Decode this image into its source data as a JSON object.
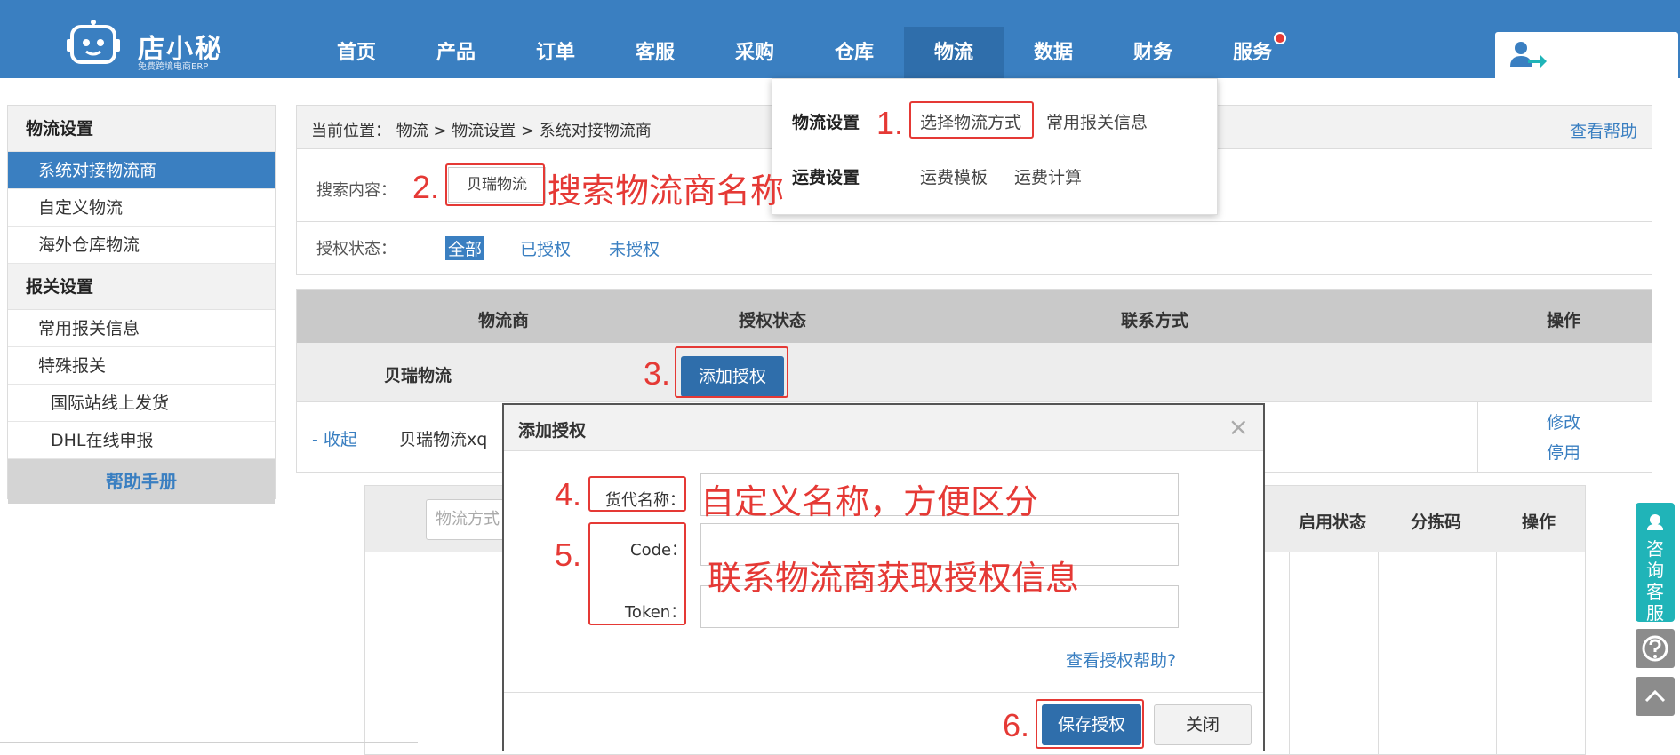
{
  "brand": {
    "name": "店小秘",
    "tagline": "免费跨境电商ERP"
  },
  "nav": {
    "items": [
      {
        "label": "首页"
      },
      {
        "label": "产品"
      },
      {
        "label": "订单"
      },
      {
        "label": "客服"
      },
      {
        "label": "采购"
      },
      {
        "label": "仓库"
      },
      {
        "label": "物流"
      },
      {
        "label": "数据"
      },
      {
        "label": "财务"
      },
      {
        "label": "服务"
      }
    ],
    "active": "物流"
  },
  "sidebar": {
    "section1": "物流设置",
    "items1": [
      {
        "label": "系统对接物流商"
      },
      {
        "label": "自定义物流"
      },
      {
        "label": "海外仓库物流"
      }
    ],
    "section2": "报关设置",
    "items2": [
      {
        "label": "常用报关信息"
      },
      {
        "label": "特殊报关"
      }
    ],
    "subitems": [
      {
        "label": "国际站线上发货"
      },
      {
        "label": "DHL在线申报"
      }
    ],
    "help": "帮助手册"
  },
  "breadcrumb": {
    "label": "当前位置：  物流 >  物流设置 > 系统对接物流商",
    "help_link": "查看帮助"
  },
  "filters": {
    "search_label": "搜索内容：",
    "search_value": "贝瑞物流",
    "status_label": "授权状态：",
    "status_options": [
      {
        "label": "全部"
      },
      {
        "label": "已授权"
      },
      {
        "label": "未授权"
      }
    ]
  },
  "table": {
    "headers": [
      "物流商",
      "授权状态",
      "联系方式",
      "操作"
    ],
    "row1": {
      "name": "贝瑞物流",
      "button": "添加授权"
    },
    "row2": {
      "collapse": "- 收起",
      "name": "贝瑞物流xq",
      "actions": [
        "修改",
        "停用"
      ]
    }
  },
  "subtable": {
    "input_placeholder": "物流方式",
    "headers": [
      "启用状态",
      "分拣码",
      "操作"
    ]
  },
  "dropdown": {
    "group1_title": "物流设置",
    "group1_items": [
      "选择物流方式",
      "常用报关信息"
    ],
    "group2_title": "运费设置",
    "group2_items": [
      "运费模板",
      "运费计算"
    ]
  },
  "modal": {
    "title": "添加授权",
    "close": "×",
    "fields": [
      {
        "label": "货代名称："
      },
      {
        "label": "Code："
      },
      {
        "label": "Token："
      }
    ],
    "help_link": "查看授权帮助?",
    "save": "保存授权",
    "cancel": "关闭"
  },
  "annotations": {
    "n1": "1.",
    "n2": "2.",
    "n3": "3.",
    "n4": "4.",
    "n5": "5.",
    "n6": "6.",
    "t2": "搜索物流商名称",
    "t4": "自定义名称，方便区分",
    "t5": "联系物流商获取授权信息"
  },
  "float": {
    "consult": "咨询客服"
  },
  "colors": {
    "primary": "#3a7fc1",
    "primary_dark": "#2f6eab",
    "annotation": "#e53935",
    "consult": "#20b4b8"
  }
}
